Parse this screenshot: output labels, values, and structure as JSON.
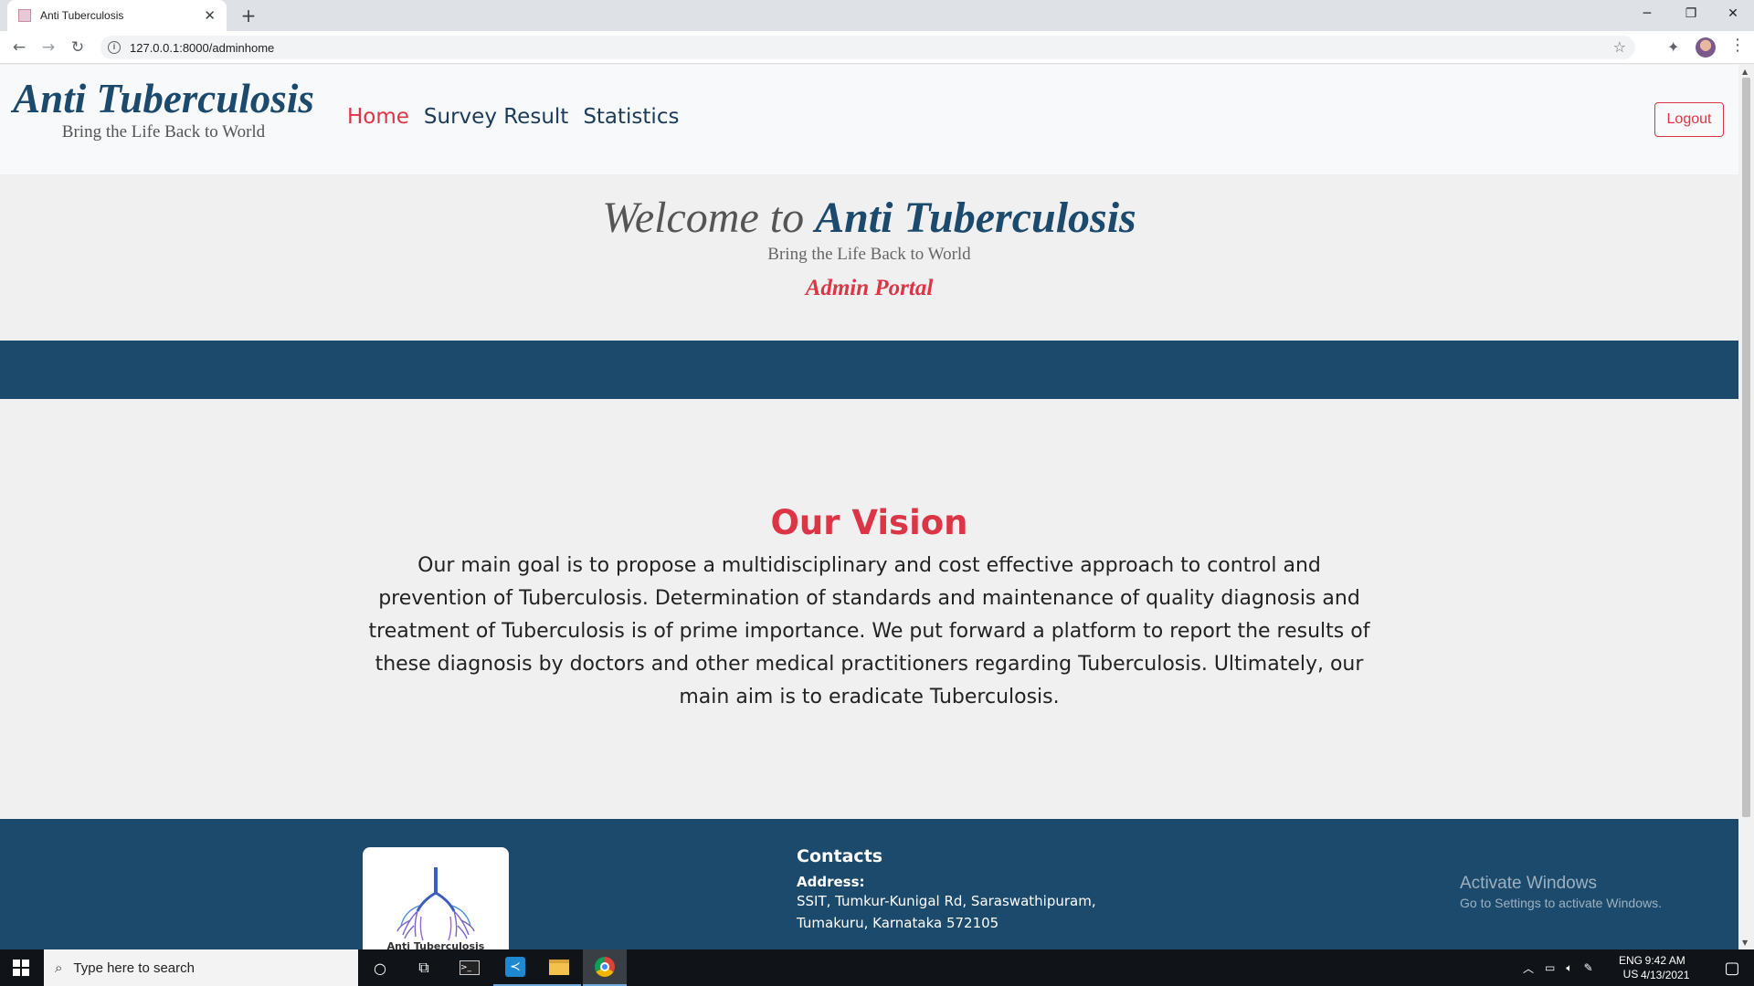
{
  "browser": {
    "tab_title": "Anti Tuberculosis",
    "url": "127.0.0.1:8000/adminhome"
  },
  "header": {
    "brand_title": "Anti Tuberculosis",
    "brand_subtitle": "Bring the Life Back to World",
    "nav": [
      {
        "label": "Home",
        "active": true
      },
      {
        "label": "Survey Result",
        "active": false
      },
      {
        "label": "Statistics",
        "active": false
      }
    ],
    "logout_label": "Logout"
  },
  "welcome": {
    "prefix": "Welcome to",
    "name": "Anti Tuberculosis",
    "subtitle": "Bring the Life Back to World",
    "portal": "Admin Portal"
  },
  "vision": {
    "title": "Our Vision",
    "text": "Our main goal is to propose a multidisciplinary and cost effective approach to control and prevention of Tuberculosis. Determination of standards and maintenance of quality diagnosis and treatment of Tuberculosis is of prime importance. We put forward a platform to report the results of these diagnosis by doctors and other medical practitioners regarding Tuberculosis. Ultimately, our main aim is to eradicate Tuberculosis."
  },
  "footer": {
    "logo_caption": "Anti Tuberculosis",
    "contacts_title": "Contacts",
    "address_label": "Address:",
    "address_line1": "SSIT, Tumkur-Kunigal Rd, Saraswathipuram,",
    "address_line2": "Tumakuru, Karnataka 572105"
  },
  "watermark": {
    "line1": "Activate Windows",
    "line2": "Go to Settings to activate Windows."
  },
  "taskbar": {
    "search_placeholder": "Type here to search",
    "lang_line1": "ENG",
    "lang_line2": "US",
    "time": "9:42 AM",
    "date": "4/13/2021"
  },
  "colors": {
    "primary": "#1c4a6c",
    "accent": "#dc3545"
  }
}
